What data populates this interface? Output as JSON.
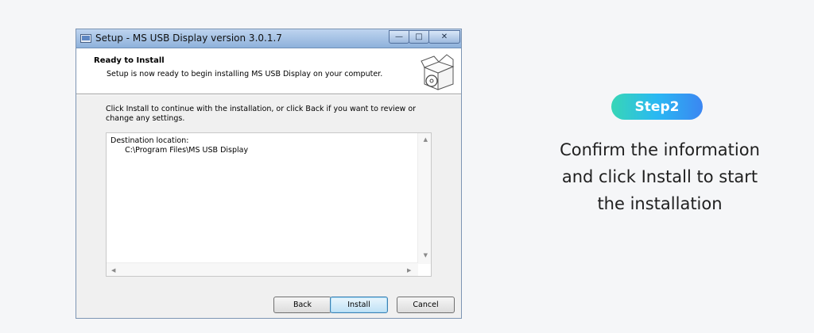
{
  "window": {
    "title": "Setup - MS USB Display version 3.0.1.7",
    "controls": {
      "minimize": "—",
      "maximize": "□",
      "close": "✕"
    }
  },
  "header": {
    "title": "Ready to Install",
    "subtitle": "Setup is now ready to begin installing MS USB Display on your computer."
  },
  "body": {
    "message": "Click Install to continue with the installation, or click Back if you want to review or change any settings.",
    "memo": "Destination location:\n      C:\\Program Files\\MS USB Display"
  },
  "buttons": {
    "back": "Back",
    "install": "Install",
    "cancel": "Cancel"
  },
  "step": {
    "badge": "Step2",
    "line1": "Confirm the information",
    "line2": "and click Install to start",
    "line3": "the installation"
  },
  "icons": [
    "app-icon",
    "software-box-icon"
  ],
  "colors": {
    "badge_start": "#37d6b6",
    "badge_end": "#3b86f2",
    "titlebar": "#a9c5e8"
  }
}
